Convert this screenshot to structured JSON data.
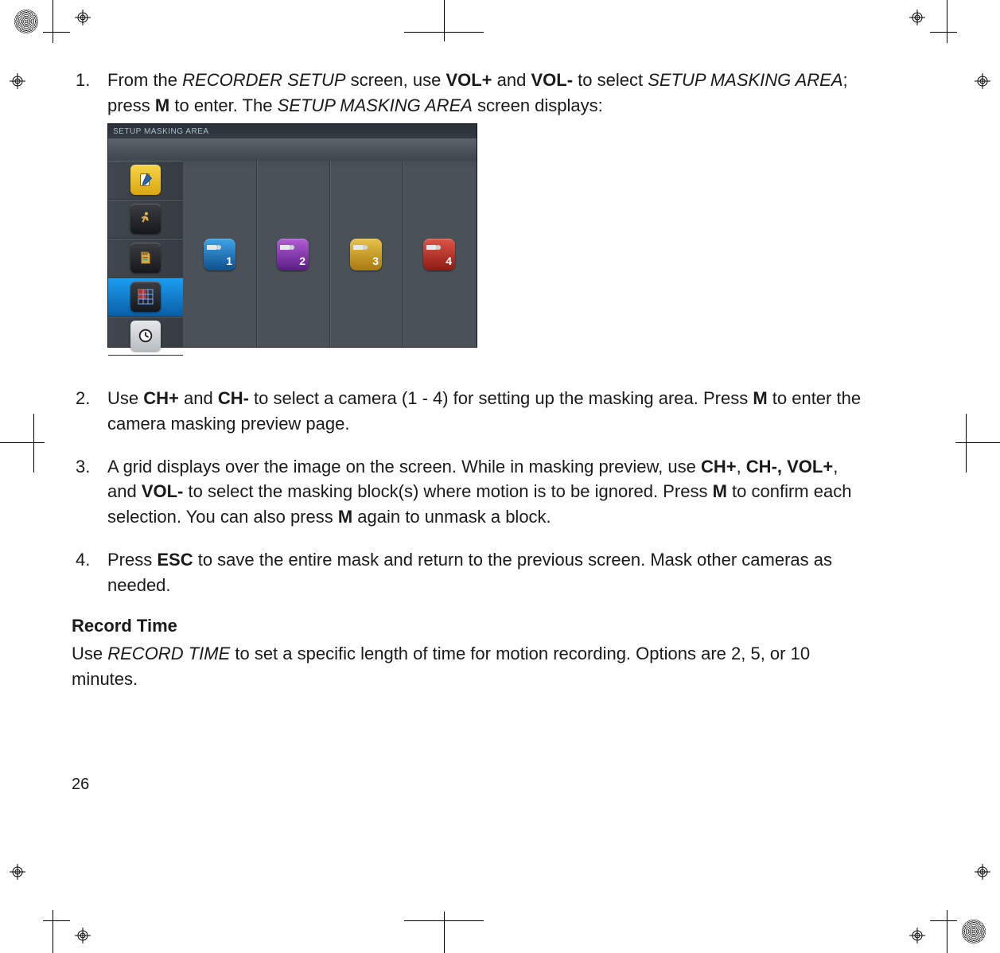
{
  "page_number": "26",
  "steps": {
    "s1_a": "From the ",
    "s1_i1": "RECORDER SETUP",
    "s1_b": " screen, use ",
    "s1_k1": "VOL+",
    "s1_c": " and ",
    "s1_k2": "VOL-",
    "s1_d": " to select ",
    "s1_i2": "SETUP MASKING AREA",
    "s1_e": "; press ",
    "s1_k3": "M",
    "s1_f": " to enter. The ",
    "s1_i3": "SETUP MASKING AREA",
    "s1_g": " screen displays:",
    "s2_a": "Use ",
    "s2_k1": "CH+",
    "s2_b": " and ",
    "s2_k2": "CH-",
    "s2_c": " to select a camera (1 - 4) for setting up the masking area. Press ",
    "s2_k3": "M",
    "s2_d": " to enter the camera masking preview page.",
    "s3_a": "A grid displays over the image on the screen. While in masking preview, use ",
    "s3_k1": "CH+",
    "s3_b": ", ",
    "s3_k2": "CH-, VOL+",
    "s3_c": ", and ",
    "s3_k3": "VOL-",
    "s3_d": " to select the masking block(s) where motion is to be ignored. Press ",
    "s3_k4": "M",
    "s3_e": " to confirm each selection. You can also press ",
    "s3_k5": "M",
    "s3_f": " again to unmask a block.",
    "s4_a": "Press ",
    "s4_k1": "ESC",
    "s4_b": " to save the entire mask and return to the previous screen. Mask other cameras as needed."
  },
  "section_heading": "Record Time",
  "section_body_a": "Use ",
  "section_body_i": "RECORD TIME",
  "section_body_b": " to set a specific length of time for motion recording. Options are 2, 5, or 10 minutes.",
  "screenshot": {
    "title": "SETUP MASKING AREA",
    "cameras": [
      "1",
      "2",
      "3",
      "4"
    ]
  }
}
